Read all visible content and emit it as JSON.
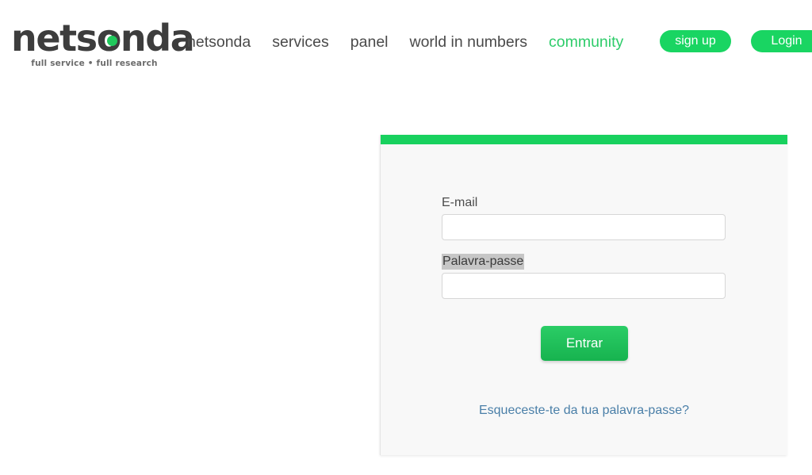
{
  "header": {
    "logo": {
      "word": "netsonda",
      "tagline": "full service • full research",
      "dot_icon": "green-dot-icon",
      "accent_color": "#20c95c"
    },
    "nav": [
      {
        "label": "netsonda",
        "accent": false
      },
      {
        "label": "services",
        "accent": false
      },
      {
        "label": "panel",
        "accent": false
      },
      {
        "label": "world in numbers",
        "accent": false
      },
      {
        "label": "community",
        "accent": true
      }
    ],
    "buttons": {
      "sign_up": "sign up",
      "login": "Login"
    }
  },
  "login_card": {
    "accent_bar_color": "#18d15e",
    "email": {
      "label": "E-mail",
      "value": "",
      "placeholder": ""
    },
    "password": {
      "label": "Palavra-passe",
      "value": "",
      "placeholder": "",
      "label_selected": true
    },
    "submit_label": "Entrar",
    "forgot_password_link": "Esqueceste-te da tua palavra-passe?"
  }
}
